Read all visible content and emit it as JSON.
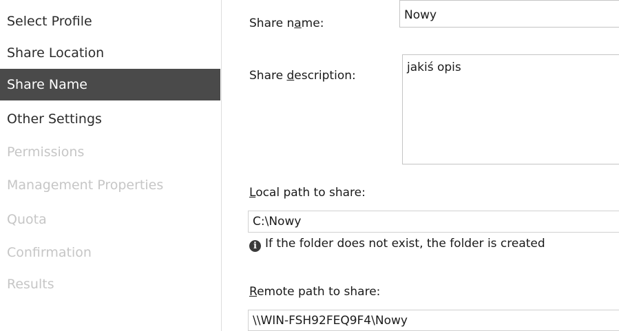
{
  "sidebar": {
    "items": [
      {
        "label": "Select Profile",
        "state": "enabled"
      },
      {
        "label": "Share Location",
        "state": "enabled"
      },
      {
        "label": "Share Name",
        "state": "active"
      },
      {
        "label": "Other Settings",
        "state": "enabled"
      },
      {
        "label": "Permissions",
        "state": "disabled"
      },
      {
        "label": "Management Properties",
        "state": "disabled"
      },
      {
        "label": "Quota",
        "state": "disabled"
      },
      {
        "label": "Confirmation",
        "state": "disabled"
      },
      {
        "label": "Results",
        "state": "disabled"
      }
    ]
  },
  "form": {
    "share_name": {
      "label_pre": "Share n",
      "label_key": "a",
      "label_post": "me:",
      "value": "Nowy"
    },
    "share_description": {
      "label_pre": "Share ",
      "label_key": "d",
      "label_post": "escription:",
      "value": "jakiś opis"
    },
    "local_path": {
      "label_key": "L",
      "label_post": "ocal path to share:",
      "value": "C:\\Nowy"
    },
    "info_text": "If the folder does not exist, the folder is created",
    "remote_path": {
      "label_key": "R",
      "label_post": "emote path to share:",
      "value": "\\\\WIN-FSH92FEQ9F4\\Nowy"
    }
  },
  "icons": {
    "info": "info-icon"
  },
  "colors": {
    "active_bg": "#4a4a4a",
    "disabled_text": "#c6c6c6"
  }
}
